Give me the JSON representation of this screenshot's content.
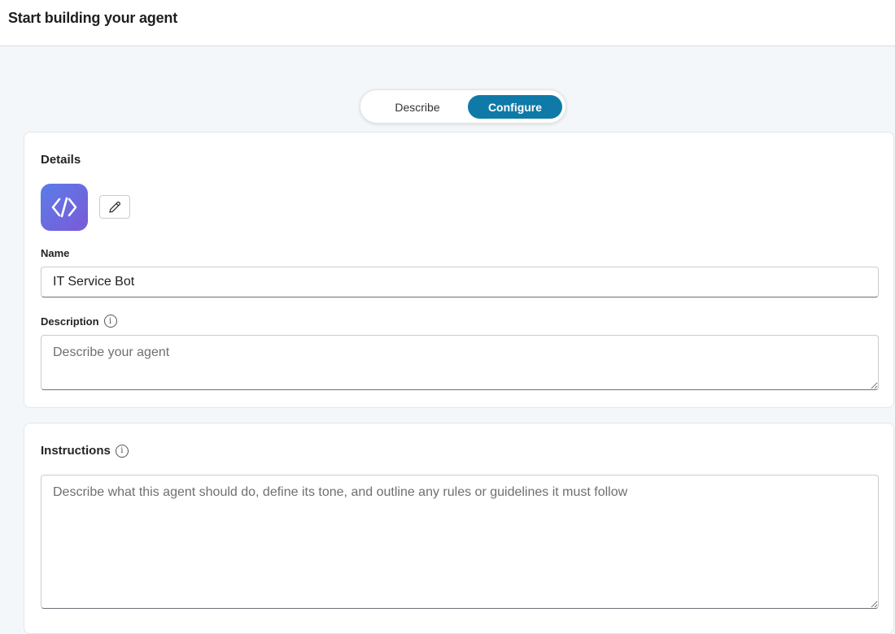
{
  "header": {
    "title": "Start building your agent"
  },
  "mode_toggle": {
    "options": [
      {
        "label": "Describe",
        "selected": false
      },
      {
        "label": "Configure",
        "selected": true
      }
    ]
  },
  "details": {
    "title": "Details",
    "agent_icon": "code-brackets-icon",
    "edit_icon": "pencil-icon",
    "name": {
      "label": "Name",
      "value": "IT Service Bot"
    },
    "description": {
      "label": "Description",
      "placeholder": "Describe your agent",
      "value": ""
    }
  },
  "instructions": {
    "title": "Instructions",
    "placeholder": "Describe what this agent should do, define its tone, and outline any rules or guidelines it must follow",
    "value": ""
  },
  "colors": {
    "accent": "#0f7aa8",
    "icon_gradient_start": "#5b7ce8",
    "icon_gradient_end": "#7a5ad8"
  }
}
